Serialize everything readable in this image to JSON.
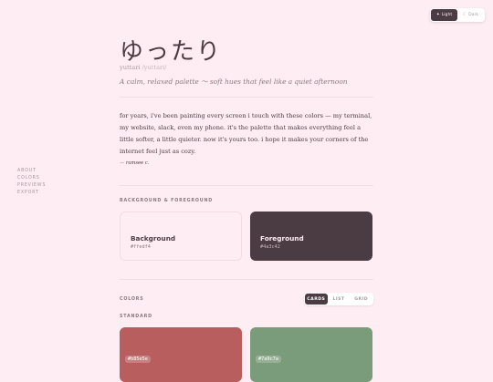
{
  "mode_toggle": {
    "light_icon": "✦",
    "light_label": "Light",
    "dark_icon": "☾",
    "dark_label": "Dark"
  },
  "nav": {
    "items": [
      "ABOUT",
      "COLORS",
      "PREVIEWS",
      "EXPORT"
    ]
  },
  "header": {
    "title": "ゆったり",
    "romaji": "yuttari",
    "reading": "/yuttari/",
    "tagline": "A calm, relaxed palette 〜 soft hues that feel like a quiet afternoon"
  },
  "about": {
    "text": "for years, i've been painting every screen i touch with these colors — my terminal, my website, slack, even my phone. it's the palette that makes everything feel a little softer, a little quieter. now it's yours too. i hope it makes your corners of the internet feel just as cozy.",
    "signature": "— ramsee c."
  },
  "bg_fg": {
    "label": "BACKGROUND & FOREGROUND",
    "background": {
      "name": "Background",
      "hex": "#ffedf4"
    },
    "foreground": {
      "name": "Foreground",
      "hex": "#4a3c42"
    }
  },
  "colors": {
    "label": "COLORS",
    "views": [
      "CARDS",
      "LIST",
      "GRID"
    ],
    "active_view": "CARDS",
    "subsection": "STANDARD",
    "swatches": [
      {
        "hex": "#b85e5e",
        "color": "#b85e5e"
      },
      {
        "hex": "#7a9c7a",
        "color": "#7a9c7a"
      }
    ]
  }
}
